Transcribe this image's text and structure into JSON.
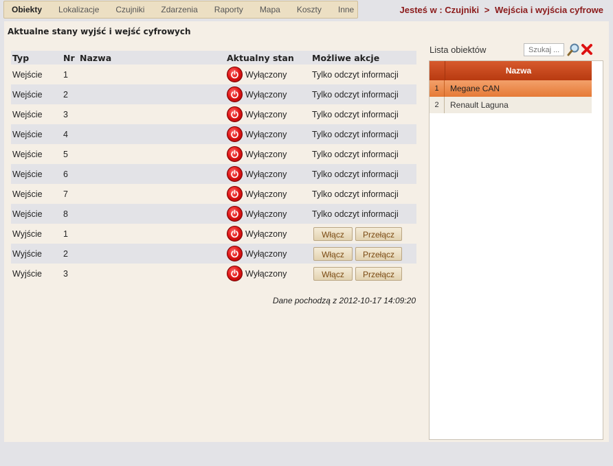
{
  "nav": {
    "items": [
      "Obiekty",
      "Lokalizacje",
      "Czujniki",
      "Zdarzenia",
      "Raporty",
      "Mapa",
      "Koszty",
      "Inne"
    ],
    "active": "Obiekty"
  },
  "breadcrumb": {
    "prefix": "Jesteś w :",
    "parts": [
      "Czujniki",
      ">",
      "Wejścia i wyjścia cyfrowe"
    ]
  },
  "panel_title": "Aktualne stany wyjść i wejść cyfrowych",
  "table": {
    "headers": [
      "Typ",
      "Nr",
      "Nazwa",
      "Aktualny stan",
      "Możliwe akcje"
    ],
    "rows": [
      {
        "typ": "Wejście",
        "nr": "1",
        "nazwa": "",
        "stan": "Wyłączony",
        "akcja": "Tylko odczyt informacji"
      },
      {
        "typ": "Wejście",
        "nr": "2",
        "nazwa": "",
        "stan": "Wyłączony",
        "akcja": "Tylko odczyt informacji"
      },
      {
        "typ": "Wejście",
        "nr": "3",
        "nazwa": "",
        "stan": "Wyłączony",
        "akcja": "Tylko odczyt informacji"
      },
      {
        "typ": "Wejście",
        "nr": "4",
        "nazwa": "",
        "stan": "Wyłączony",
        "akcja": "Tylko odczyt informacji"
      },
      {
        "typ": "Wejście",
        "nr": "5",
        "nazwa": "",
        "stan": "Wyłączony",
        "akcja": "Tylko odczyt informacji"
      },
      {
        "typ": "Wejście",
        "nr": "6",
        "nazwa": "",
        "stan": "Wyłączony",
        "akcja": "Tylko odczyt informacji"
      },
      {
        "typ": "Wejście",
        "nr": "7",
        "nazwa": "",
        "stan": "Wyłączony",
        "akcja": "Tylko odczyt informacji"
      },
      {
        "typ": "Wejście",
        "nr": "8",
        "nazwa": "",
        "stan": "Wyłączony",
        "akcja": "Tylko odczyt informacji"
      },
      {
        "typ": "Wyjście",
        "nr": "1",
        "nazwa": "",
        "stan": "Wyłączony",
        "buttons": [
          "Włącz",
          "Przełącz"
        ]
      },
      {
        "typ": "Wyjście",
        "nr": "2",
        "nazwa": "",
        "stan": "Wyłączony",
        "buttons": [
          "Włącz",
          "Przełącz"
        ]
      },
      {
        "typ": "Wyjście",
        "nr": "3",
        "nazwa": "",
        "stan": "Wyłączony",
        "buttons": [
          "Włącz",
          "Przełącz"
        ]
      }
    ],
    "status_icon": "power-off-icon"
  },
  "timestamp": "Dane pochodzą z 2012-10-17 14:09:20",
  "object_list": {
    "label": "Lista obiektów",
    "search_placeholder": "Szukaj ...",
    "header": "Nazwa",
    "items": [
      {
        "num": "1",
        "name": "Megane CAN",
        "selected": true
      },
      {
        "num": "2",
        "name": "Renault Laguna",
        "selected": false
      }
    ]
  },
  "colors": {
    "accent": "#b83a10",
    "selected_row": "#e57a36",
    "breadcrumb": "#8b1a1a",
    "panel_bg": "#f5efe6",
    "stripe": "#e3e3e7",
    "power_icon": "#e01818"
  }
}
